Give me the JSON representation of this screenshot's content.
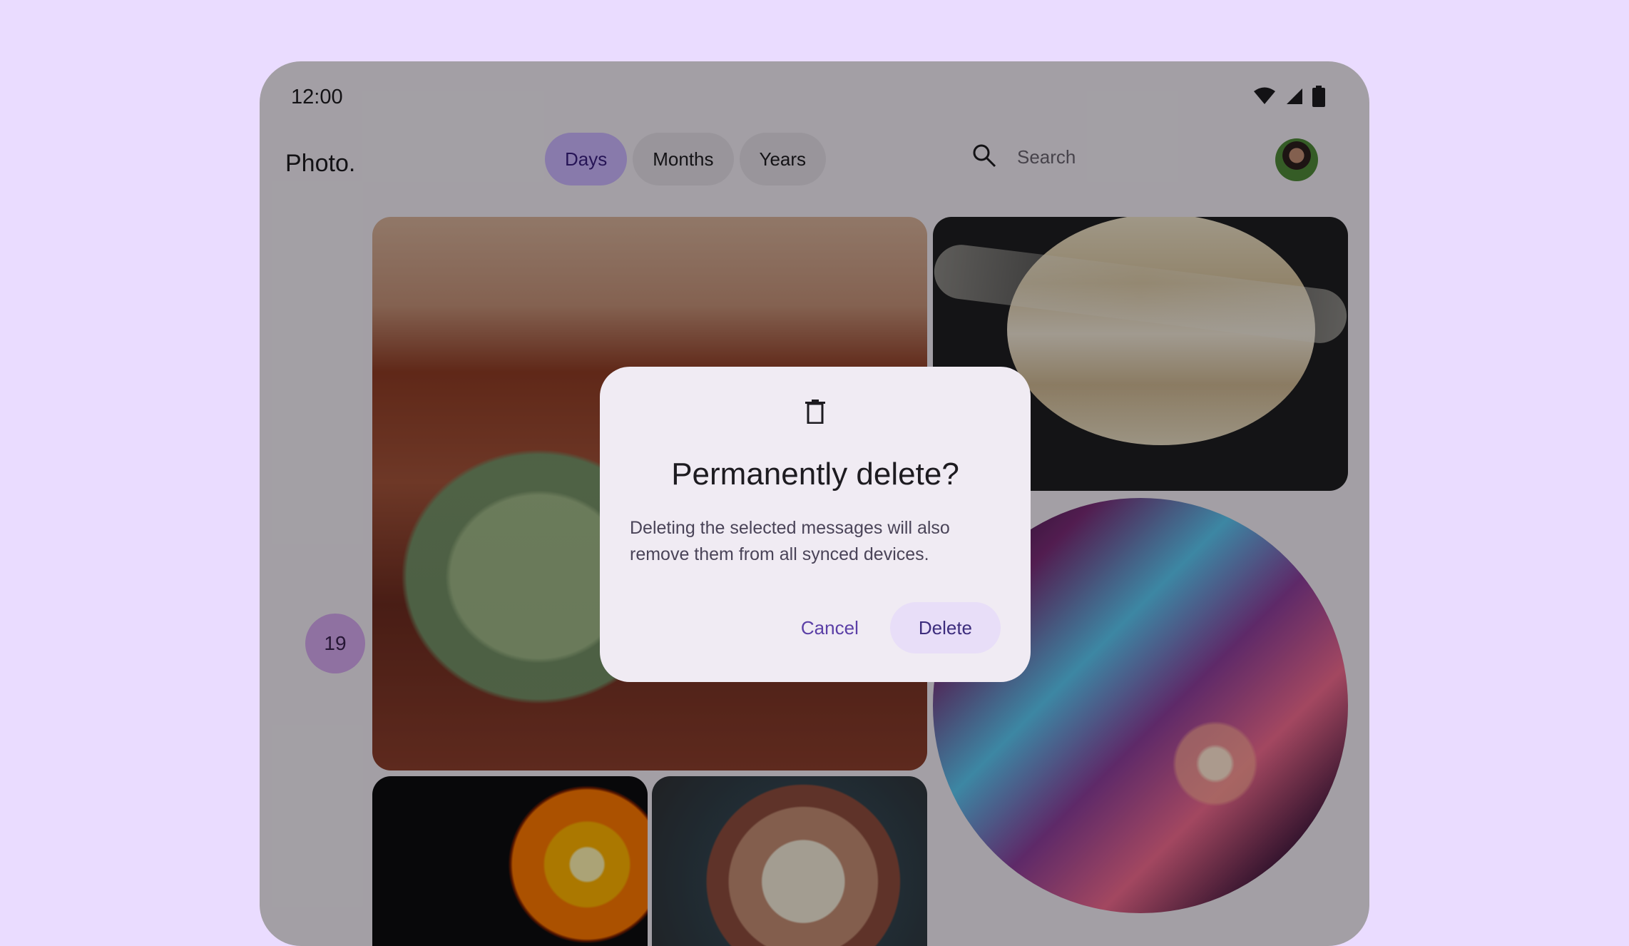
{
  "status_bar": {
    "time": "12:00",
    "icons": [
      "wifi-icon",
      "signal-icon",
      "battery-icon"
    ]
  },
  "app_bar": {
    "title": "Photo.",
    "tabs": [
      {
        "label": "Days",
        "selected": true
      },
      {
        "label": "Months",
        "selected": false
      },
      {
        "label": "Years",
        "selected": false
      }
    ],
    "search": {
      "placeholder": "Search",
      "icon": "search-icon"
    },
    "avatar": "avatar"
  },
  "gallery": {
    "date_chip": "19",
    "photos": [
      "mars-habitat-photo",
      "saturn-photo",
      "nebula-photo",
      "sun-photo",
      "pluto-photo"
    ]
  },
  "dialog": {
    "icon": "trash-icon",
    "title": "Permanently delete?",
    "body": "Deleting the selected messages will also remove them from all synced devices.",
    "cancel": "Cancel",
    "delete": "Delete"
  },
  "colors": {
    "page_background": "#eadcff",
    "accent": "#cbb6ff",
    "dialog_background": "#f0ebf3",
    "primary_text": "#1d1b20"
  }
}
